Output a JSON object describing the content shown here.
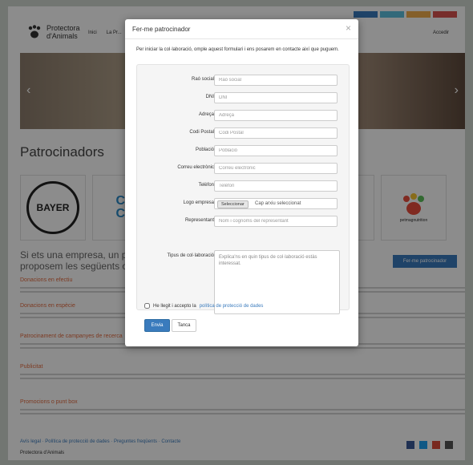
{
  "background": {
    "logo_text_line1": "Protectora",
    "logo_text_line2": "d'Animals",
    "nav_links": [
      "Inici",
      "La Pr..."
    ],
    "login_label": "Accedir",
    "top_buttons": [
      "",
      "",
      "",
      ""
    ],
    "section_title": "Patrocinadors",
    "sponsor_bayer": "BAYER",
    "sponsor_partial_1": "CA\nCI",
    "sponsor_partial_2": "ree",
    "sponsor_last": "petmagnutrition",
    "cta_text_line1": "Si ets una empresa, un pr",
    "cta_text_line2": "proposem les següents opci",
    "cta_button": "Fer-me patrocinador",
    "subheads": [
      "Donacions en efectiu",
      "Donacions en espècie",
      "Patrocinament de campanyes de recerca",
      "Publicitat",
      "Promocions o punt box"
    ],
    "footer_links": "Avís legal · Política de protecció de dades · Preguntes freqüents · Contacte",
    "footer_logo": "Protectora d'Animals"
  },
  "modal": {
    "title": "Fer-me patrocinador",
    "close_symbol": "×",
    "intro": "Per iniciar la col·laboració, omple aquest formulari i ens posarem en contacte així que puguem.",
    "fields": [
      {
        "label": "Raó social",
        "placeholder": "Raó social"
      },
      {
        "label": "DNI",
        "placeholder": "DNI"
      },
      {
        "label": "Adreça",
        "placeholder": "Adreça"
      },
      {
        "label": "Codi Postal",
        "placeholder": "Codi Postal"
      },
      {
        "label": "Població",
        "placeholder": "Població"
      },
      {
        "label": "Correu electrònic",
        "placeholder": "Correu electrònic"
      },
      {
        "label": "Telèfon",
        "placeholder": "Telèfon"
      }
    ],
    "logo_field": {
      "label": "Logo empresa",
      "button": "Seleccionar",
      "status": "Cap arxiu seleccionat"
    },
    "representant": {
      "label": "Representant",
      "placeholder": "Nom i cognoms del representant"
    },
    "collab_type": {
      "label": "Tipus de col·laboració",
      "placeholder": "Explica'ns en quin tipus de col·laboració estàs interessat."
    },
    "consent_prefix": "He llegit i accepto la",
    "consent_link": "política de protecció de dades",
    "send_button": "Envia",
    "close_button": "Tanca"
  }
}
